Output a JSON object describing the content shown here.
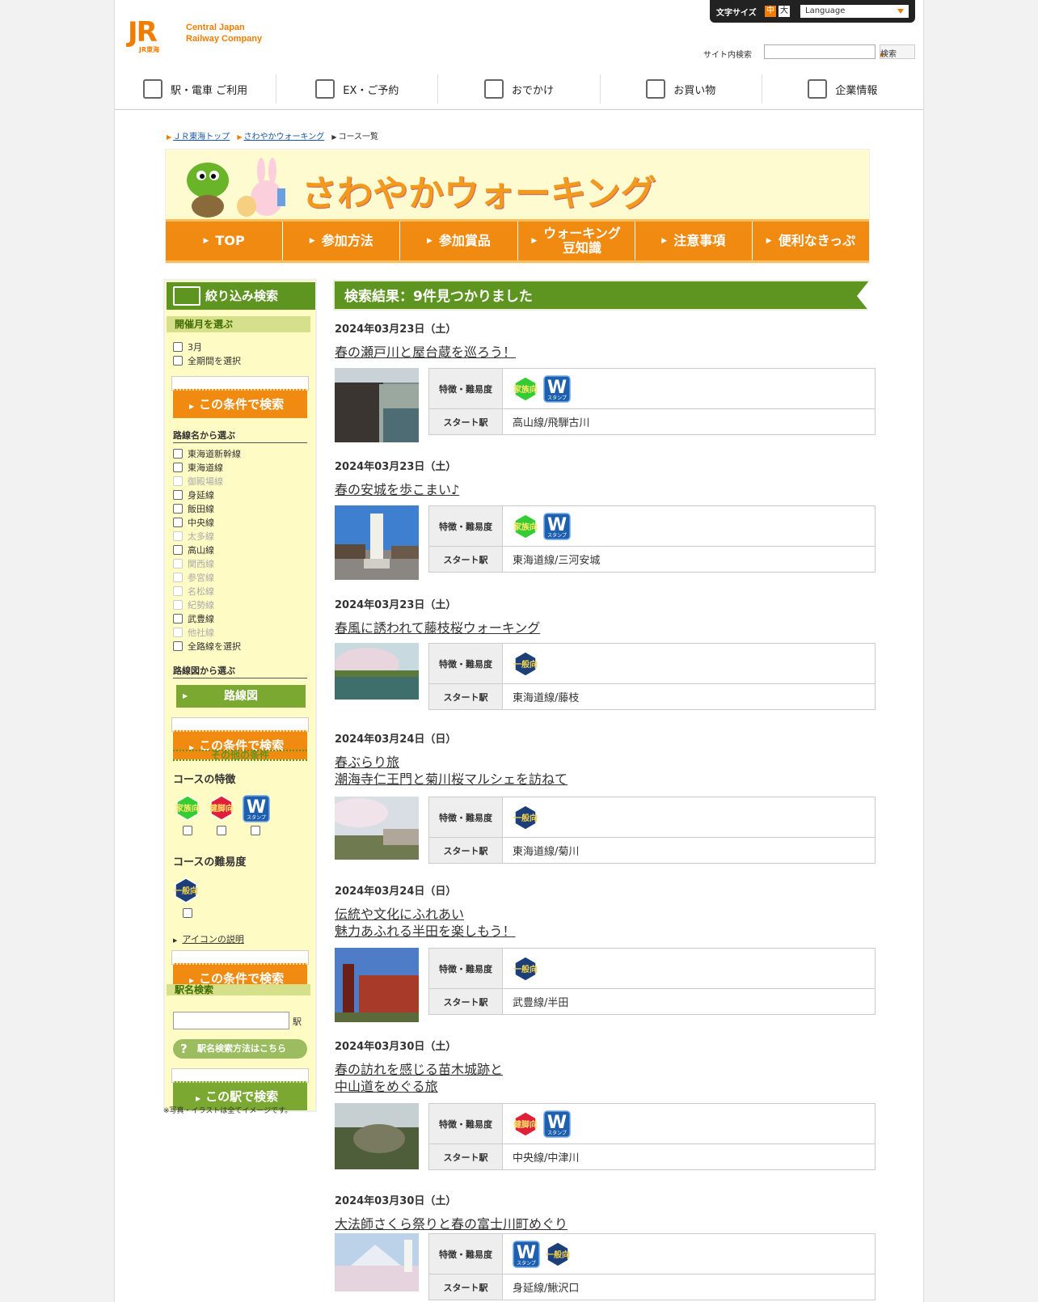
{
  "header": {
    "company_line1": "Central Japan",
    "company_line2": "Railway Company",
    "logo_sub": "JR東海",
    "fontsize_label": "文字サイズ",
    "size_mid": "中",
    "size_large": "大",
    "language": "Language",
    "search_label": "サイト内検索",
    "search_button": "検索"
  },
  "gnav": [
    {
      "label": "駅・電車 ご利用",
      "icon": "train-icon"
    },
    {
      "label": "EX・ご予約",
      "icon": "ticket-icon"
    },
    {
      "label": "おでかけ",
      "icon": "suitcase-icon"
    },
    {
      "label": "お買い物",
      "icon": "shopping-bag-icon"
    },
    {
      "label": "企業情報",
      "icon": "building-icon"
    }
  ],
  "breadcrumb": [
    "ＪＲ東海トップ",
    "さわやかウォーキング",
    "コース一覧"
  ],
  "banner": {
    "title": "さわやかウォーキング",
    "nav": [
      "TOP",
      "参加方法",
      "参加賞品",
      "ウォーキング\n豆知識",
      "注意事項",
      "便利なきっぷ"
    ]
  },
  "sidebar": {
    "heading": "絞り込み検索",
    "month_band": "開催月を選ぶ",
    "months": [
      "3月",
      "全期間を選択"
    ],
    "search_btn": "この条件で検索",
    "line_heading": "路線名から選ぶ",
    "lines": [
      {
        "label": "東海道新幹線",
        "enabled": true
      },
      {
        "label": "東海道線",
        "enabled": true
      },
      {
        "label": "御殿場線",
        "enabled": false
      },
      {
        "label": "身延線",
        "enabled": true
      },
      {
        "label": "飯田線",
        "enabled": true
      },
      {
        "label": "中央線",
        "enabled": true
      },
      {
        "label": "太多線",
        "enabled": false
      },
      {
        "label": "高山線",
        "enabled": true
      },
      {
        "label": "関西線",
        "enabled": false
      },
      {
        "label": "参宮線",
        "enabled": false
      },
      {
        "label": "名松線",
        "enabled": false
      },
      {
        "label": "紀勢線",
        "enabled": false
      },
      {
        "label": "武豊線",
        "enabled": true
      },
      {
        "label": "他社線",
        "enabled": false
      },
      {
        "label": "全路線を選択",
        "enabled": true
      }
    ],
    "map_heading": "路線図から選ぶ",
    "map_btn": "路線図",
    "other_band": "その他の条件",
    "feature_heading": "コースの特徴",
    "difficulty_heading": "コースの難易度",
    "icon_help": "アイコンの説明",
    "station_band": "駅名検索",
    "station_suffix": "駅",
    "station_help": "駅名検索方法はこちら",
    "station_btn": "この駅で検索",
    "note": "※写真・イラストは全てイメージです。"
  },
  "badges": {
    "family": "家族向",
    "strong": "健脚向",
    "general": "一般向",
    "stamp_w": "W",
    "stamp_sub": "スタンプ"
  },
  "results": {
    "heading": "検索結果：9件見つかりました",
    "key_feature": "特徴・難易度",
    "key_start": "スタート駅",
    "items": [
      {
        "date": "2024年03月23日（土）",
        "title": "春の瀬戸川と屋台蔵を巡ろう！",
        "badges": [
          "family",
          "stamp"
        ],
        "start": "高山線/飛騨古川",
        "img": "canal"
      },
      {
        "date": "2024年03月23日（土）",
        "title": "春の安城を歩こまい♪",
        "badges": [
          "family",
          "stamp"
        ],
        "start": "東海道線/三河安城",
        "img": "statue"
      },
      {
        "date": "2024年03月23日（土）",
        "title": "春風に誘われて藤枝桜ウォーキング",
        "badges": [
          "general"
        ],
        "start": "東海道線/藤枝",
        "img": "pond"
      },
      {
        "date": "2024年03月24日（日）",
        "title": "春ぶらり旅\n潮海寺仁王門と菊川桜マルシェを訪ねて",
        "badges": [
          "general"
        ],
        "start": "東海道線/菊川",
        "img": "cherry"
      },
      {
        "date": "2024年03月24日（日）",
        "title": "伝統や文化にふれあい\n魅力あふれる半田を楽しもう！",
        "badges": [
          "general"
        ],
        "start": "武豊線/半田",
        "img": "brick"
      },
      {
        "date": "2024年03月30日（土）",
        "title": "春の訪れを感じる苗木城跡と\n中山道をめぐる旅",
        "badges": [
          "strong",
          "stamp"
        ],
        "start": "中央線/中津川",
        "img": "castle"
      },
      {
        "date": "2024年03月30日（土）",
        "title": "大法師さくら祭りと春の富士川町めぐり",
        "badges": [
          "stamp",
          "general"
        ],
        "start": "身延線/鰍沢口",
        "img": "fuji"
      }
    ]
  }
}
